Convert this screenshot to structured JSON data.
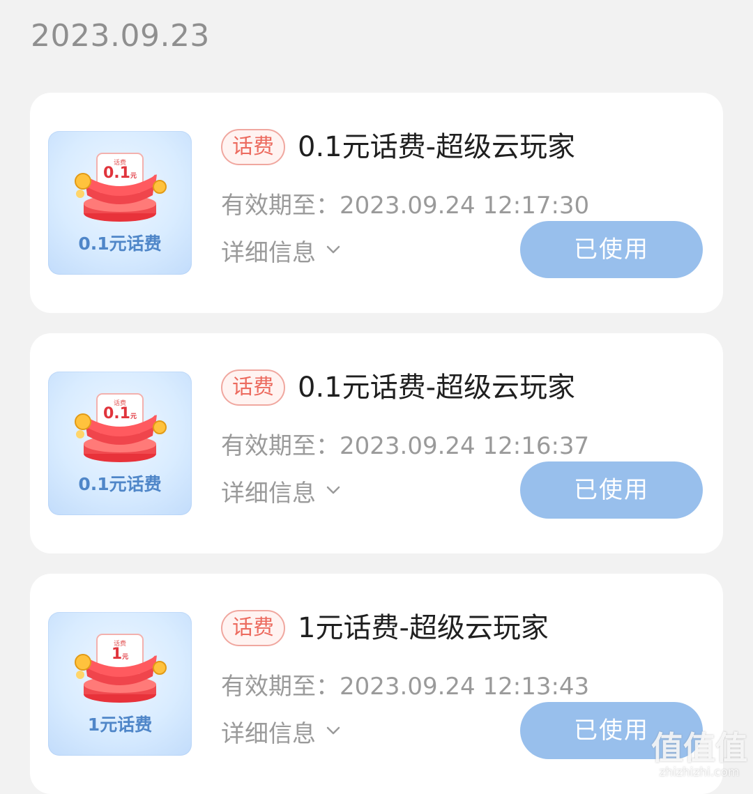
{
  "date_header": "2023.09.23",
  "cards": [
    {
      "tag": "话费",
      "title": "0.1元话费-超级云玩家",
      "valid_prefix": "有效期至：",
      "valid_until": "2023.09.24 12:17:30",
      "detail_label": "详细信息",
      "button_label": "已使用",
      "thumb_label": "0.1元话费",
      "thumb_badge_top": "话费",
      "thumb_badge_value": "0.1",
      "thumb_badge_unit": "元"
    },
    {
      "tag": "话费",
      "title": "0.1元话费-超级云玩家",
      "valid_prefix": "有效期至：",
      "valid_until": "2023.09.24 12:16:37",
      "detail_label": "详细信息",
      "button_label": "已使用",
      "thumb_label": "0.1元话费",
      "thumb_badge_top": "话费",
      "thumb_badge_value": "0.1",
      "thumb_badge_unit": "元"
    },
    {
      "tag": "话费",
      "title": "1元话费-超级云玩家",
      "valid_prefix": "有效期至：",
      "valid_until": "2023.09.24 12:13:43",
      "detail_label": "详细信息",
      "button_label": "已使用",
      "thumb_label": "1元话费",
      "thumb_badge_top": "话费",
      "thumb_badge_value": "1",
      "thumb_badge_unit": "元"
    }
  ],
  "watermark": {
    "logo_text": "值值值",
    "site": "zhizhizhi.com"
  },
  "colors": {
    "background": "#f2f2f2",
    "card": "#ffffff",
    "tag_border": "#f0a79f",
    "tag_text": "#ec6a5e",
    "button_bg": "#98bfec",
    "thumb_label": "#4f86c8"
  },
  "icons": {
    "detail_chevron": "chevron-down-icon",
    "thumb": "red-envelope-coins-icon"
  }
}
